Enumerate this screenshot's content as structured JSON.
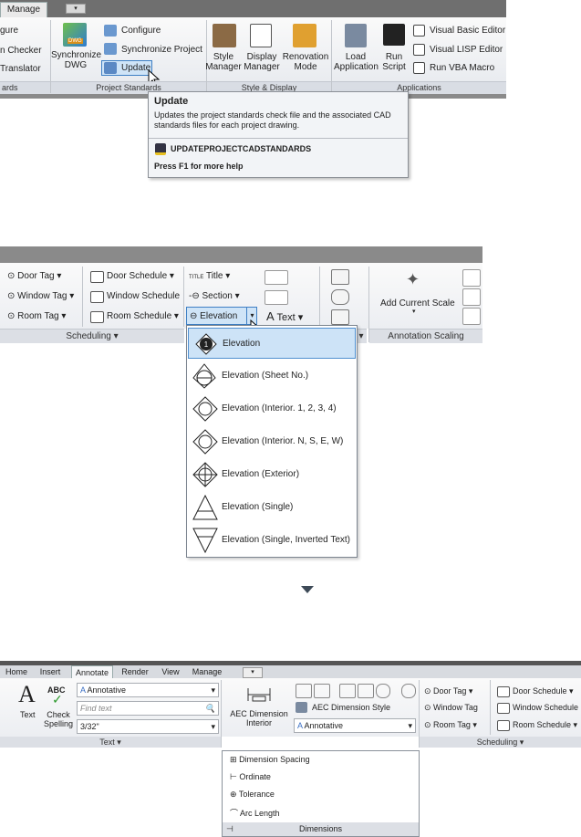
{
  "panel1": {
    "tab_manage": "Manage",
    "qat": "▾",
    "left_items": [
      "gure",
      "n Checker",
      "Translator"
    ],
    "left_footer": "ards",
    "sync_dwg_label": "Synchronize DWG",
    "project_items": [
      "Configure",
      "Synchronize Project",
      "Update"
    ],
    "project_footer": "Project Standards",
    "style_items": [
      "Style Manager",
      "Display Manager",
      "Renovation Mode"
    ],
    "style_footer": "Style & Display",
    "app_items": [
      "Load Application",
      "Run Script"
    ],
    "app_list": [
      "Visual Basic Editor",
      "Visual LISP Editor",
      "Run VBA Macro"
    ],
    "app_footer": "Applications",
    "tooltip": {
      "title": "Update",
      "body": "Updates the project standards check file and the associated CAD standards files for each project drawing.",
      "command": "UPDATEPROJECTCADSTANDARDS",
      "help": "Press F1 for more help"
    }
  },
  "panel2": {
    "tags": [
      "Door Tag",
      "Window Tag",
      "Room Tag"
    ],
    "schedules": [
      "Door Schedule",
      "Window Schedule",
      "Room Schedule"
    ],
    "scheduling_footer": "Scheduling",
    "title_btn": "Title",
    "section_btn": "Section",
    "elevation_btn": "Elevation",
    "text_btn": "Text",
    "add_scale": "Add Current Scale",
    "scaling_footer": "Annotation Scaling",
    "menu": [
      {
        "label": "Elevation",
        "icon": "elevation-icon"
      },
      {
        "label": "Elevation (Sheet No.)",
        "icon": "elevation-sheet-icon"
      },
      {
        "label": "Elevation (Interior. 1, 2, 3, 4)",
        "icon": "elevation-interior-num-icon"
      },
      {
        "label": "Elevation (Interior. N, S, E, W)",
        "icon": "elevation-interior-compass-icon"
      },
      {
        "label": "Elevation (Exterior)",
        "icon": "elevation-exterior-icon"
      },
      {
        "label": "Elevation (Single)",
        "icon": "elevation-single-icon"
      },
      {
        "label": "Elevation (Single, Inverted Text)",
        "icon": "elevation-single-inverted-icon"
      }
    ]
  },
  "panel3": {
    "tabs": [
      "Home",
      "Insert",
      "Annotate",
      "Render",
      "View",
      "Manage"
    ],
    "text_btn": "Text",
    "check_spelling": "Check Spelling",
    "abc": "ABC",
    "text_style": "Annotative",
    "find_placeholder": "Find text",
    "text_height": "3/32\"",
    "text_footer": "Text",
    "aec_dim": "AEC Dimension Interior",
    "aec_dim_style": "AEC Dimension Style",
    "dim_style_value": "Annotative",
    "tags": [
      "Door Tag",
      "Window Tag",
      "Room Tag"
    ],
    "schedules": [
      "Door Schedule",
      "Window Schedule",
      "Room Schedule"
    ],
    "scheduling_footer": "Scheduling",
    "dropdown": [
      "Dimension Spacing",
      "Ordinate",
      "Tolerance",
      "Arc Length"
    ],
    "dropdown_footer": "Dimensions"
  }
}
